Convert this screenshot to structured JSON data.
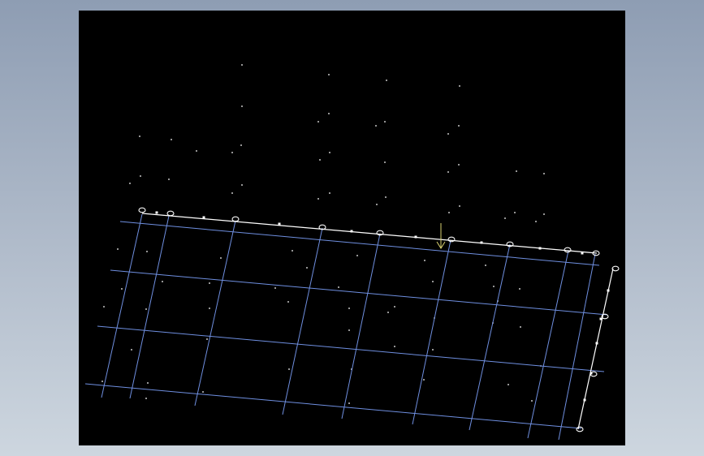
{
  "colors": {
    "background_gradient_top": "#8e9db3",
    "background_gradient_bottom": "#cdd6df",
    "viewport_background": "#000000",
    "grid_lines": "#6f8fe0",
    "edge_lines": "#ffffff",
    "points": "#ffffff",
    "marker": "#d8d070"
  },
  "icons": {
    "support_marker": "circle",
    "node_marker": "small-square",
    "load_marker": "down-arrow"
  }
}
